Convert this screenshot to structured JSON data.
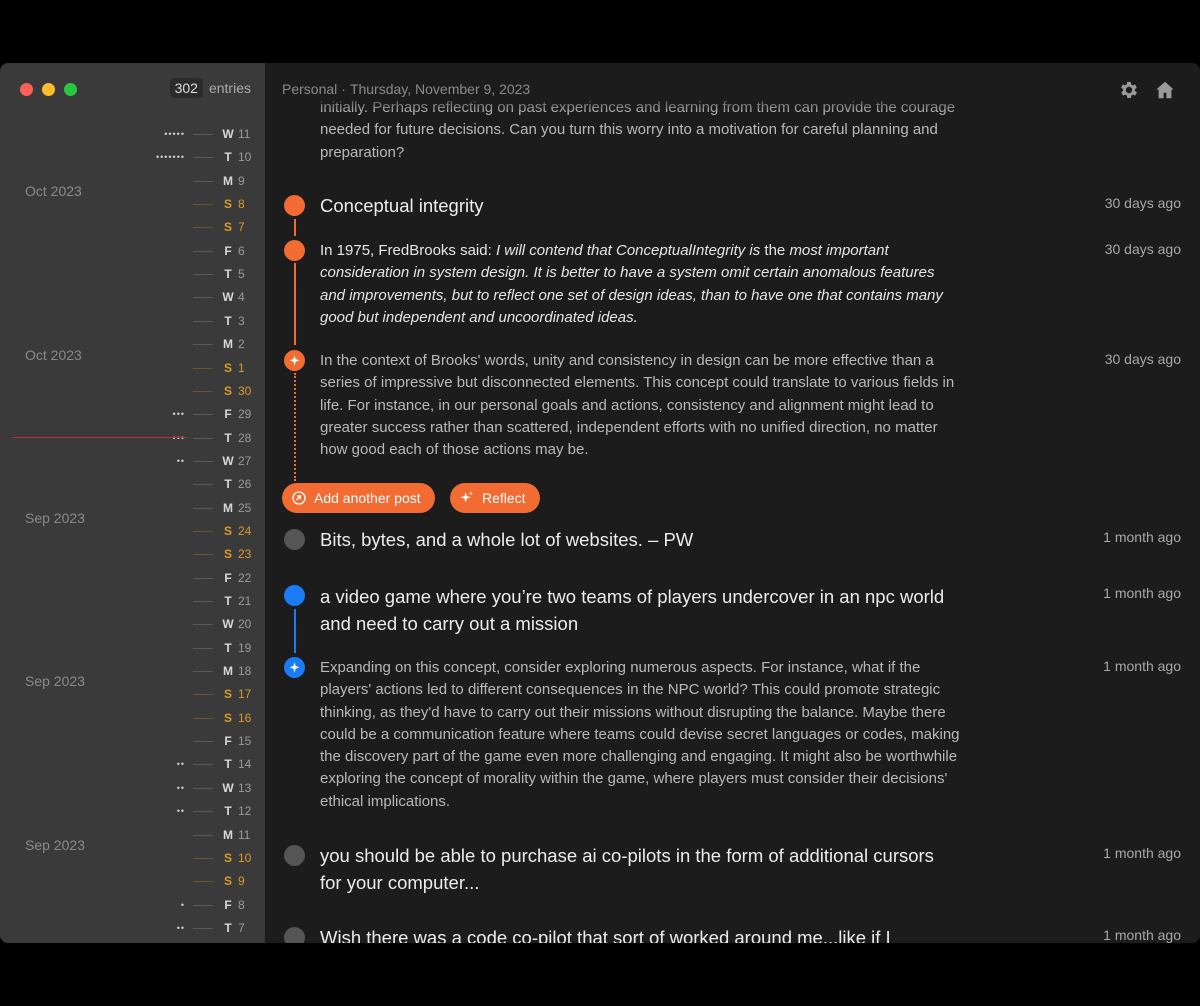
{
  "sidebar": {
    "entry_count": "302",
    "entries_label": "entries",
    "months": [
      {
        "label": "Oct 2023"
      },
      {
        "label": "Oct 2023"
      },
      {
        "label": "Sep 2023"
      },
      {
        "label": "Sep 2023"
      },
      {
        "label": "Sep 2023"
      }
    ],
    "days": [
      {
        "letter": "W",
        "num": "11",
        "dots": "•••••",
        "weekend": false
      },
      {
        "letter": "T",
        "num": "10",
        "dots": "•••••••",
        "weekend": false
      },
      {
        "letter": "M",
        "num": "9",
        "dots": "",
        "weekend": false
      },
      {
        "letter": "S",
        "num": "8",
        "dots": "",
        "weekend": true
      },
      {
        "letter": "S",
        "num": "7",
        "dots": "",
        "weekend": true
      },
      {
        "letter": "F",
        "num": "6",
        "dots": "",
        "weekend": false
      },
      {
        "letter": "T",
        "num": "5",
        "dots": "",
        "weekend": false
      },
      {
        "letter": "W",
        "num": "4",
        "dots": "",
        "weekend": false
      },
      {
        "letter": "T",
        "num": "3",
        "dots": "",
        "weekend": false
      },
      {
        "letter": "M",
        "num": "2",
        "dots": "",
        "weekend": false
      },
      {
        "letter": "S",
        "num": "1",
        "dots": "",
        "weekend": true
      },
      {
        "letter": "S",
        "num": "30",
        "dots": "",
        "weekend": true
      },
      {
        "letter": "F",
        "num": "29",
        "dots": "•••",
        "weekend": false
      },
      {
        "letter": "T",
        "num": "28",
        "dots": "•••",
        "weekend": false
      },
      {
        "letter": "W",
        "num": "27",
        "dots": "••",
        "weekend": false
      },
      {
        "letter": "T",
        "num": "26",
        "dots": "",
        "weekend": false
      },
      {
        "letter": "M",
        "num": "25",
        "dots": "",
        "weekend": false
      },
      {
        "letter": "S",
        "num": "24",
        "dots": "",
        "weekend": true
      },
      {
        "letter": "S",
        "num": "23",
        "dots": "",
        "weekend": true
      },
      {
        "letter": "F",
        "num": "22",
        "dots": "",
        "weekend": false
      },
      {
        "letter": "T",
        "num": "21",
        "dots": "",
        "weekend": false
      },
      {
        "letter": "W",
        "num": "20",
        "dots": "",
        "weekend": false
      },
      {
        "letter": "T",
        "num": "19",
        "dots": "",
        "weekend": false
      },
      {
        "letter": "M",
        "num": "18",
        "dots": "",
        "weekend": false
      },
      {
        "letter": "S",
        "num": "17",
        "dots": "",
        "weekend": true
      },
      {
        "letter": "S",
        "num": "16",
        "dots": "",
        "weekend": true
      },
      {
        "letter": "F",
        "num": "15",
        "dots": "",
        "weekend": false
      },
      {
        "letter": "T",
        "num": "14",
        "dots": "••",
        "weekend": false
      },
      {
        "letter": "W",
        "num": "13",
        "dots": "••",
        "weekend": false
      },
      {
        "letter": "T",
        "num": "12",
        "dots": "••",
        "weekend": false
      },
      {
        "letter": "M",
        "num": "11",
        "dots": "",
        "weekend": false
      },
      {
        "letter": "S",
        "num": "10",
        "dots": "",
        "weekend": true
      },
      {
        "letter": "S",
        "num": "9",
        "dots": "",
        "weekend": true
      },
      {
        "letter": "F",
        "num": "8",
        "dots": "•",
        "weekend": false
      },
      {
        "letter": "T",
        "num": "7",
        "dots": "••",
        "weekend": false
      }
    ]
  },
  "header": {
    "journal": "Personal",
    "separator": "·",
    "date": "Thursday, November 9, 2023"
  },
  "icons": {
    "settings": "gear-icon",
    "home": "home-icon",
    "reflect": "sparkle-icon",
    "add": "add-post-icon"
  },
  "colors": {
    "accent": "#f26b32",
    "blue": "#1a7bf5",
    "sidebar_bg": "#3a3a3a",
    "main_bg": "#1c1c1c"
  },
  "entries": {
    "top_fragment": "initially. Perhaps reflecting on past experiences and learning from them can provide the courage needed for future decisions. Can you turn this worry into a motivation for careful planning and preparation?",
    "conceptual_title": "Conceptual integrity",
    "conceptual_time": "30 days ago",
    "quote_prefix": "In 1975, FredBrooks said: ",
    "quote_i1": "I will contend that ConceptualIntegrity is",
    "quote_mid": " the ",
    "quote_i2": "most important consideration in system design. It is better to have a system omit certain anomalous features and improvements, but to reflect one set of design ideas, than to have one that contains many good but independent and uncoordinated ideas.",
    "quote_time": "30 days ago",
    "reflection1": "In the context of Brooks' words, unity and consistency in design can be more effective than a series of impressive but disconnected elements. This concept could translate to various fields in life. For instance, in our personal goals and actions, consistency and alignment might lead to greater success rather than scattered, independent efforts with no unified direction, no matter how good each of those actions may be.",
    "reflection1_time": "30 days ago",
    "add_another_post": "Add another post",
    "reflect": "Reflect",
    "bits_title": "Bits, bytes, and a whole lot of websites. – PW",
    "bits_time": "1 month ago",
    "game_title": "a video game where you’re two teams of players undercover in an npc world and need to carry out a mission",
    "game_time": "1 month ago",
    "reflection2": "Expanding on this concept, consider exploring numerous aspects. For instance, what if the players' actions led to different consequences in the NPC world? This could promote strategic thinking, as they'd have to carry out their missions without disrupting the balance. Maybe there could be a communication feature where teams could devise secret languages or codes, making the discovery part of the game even more challenging and engaging. It might also be worthwhile exploring the concept of morality within the game, where players must consider their decisions' ethical implications.",
    "reflection2_time": "1 month ago",
    "copilot_title": "you should be able to purchase ai co-pilots in the form of additional cursors for your computer...",
    "copilot_time": "1 month ago",
    "codepilot_title": "Wish there was a code co-pilot that sort of worked around me...like if I",
    "codepilot_time": "1 month ago"
  }
}
